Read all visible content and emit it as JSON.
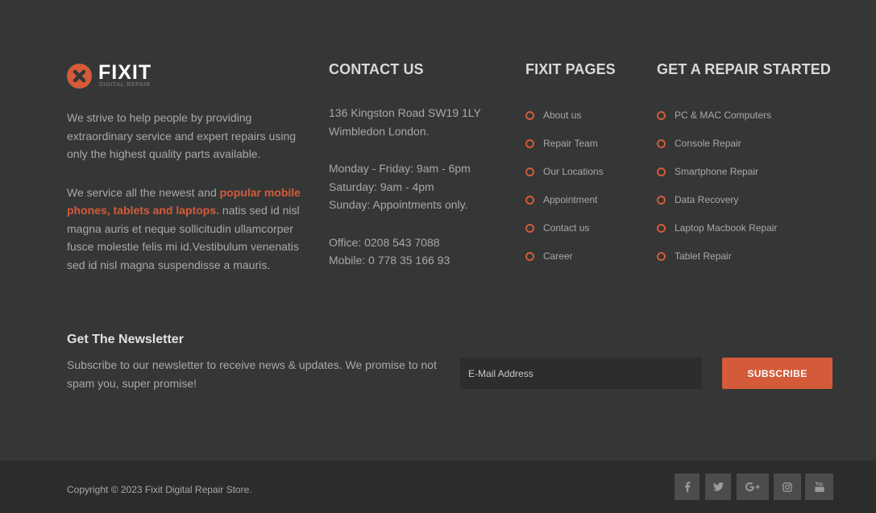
{
  "brand": {
    "name": "FIXIT",
    "tagline": "DIGITAL REPAIR",
    "accent_color": "#d35b3a"
  },
  "about": {
    "paragraph1": "We strive to help people by providing extraordinary service and expert repairs using only the highest quality parts available.",
    "paragraph2_before": "We service all the newest and ",
    "paragraph2_highlight": "popular mobile phones, tablets and laptops.",
    "paragraph2_after": " natis sed id nisl magna auris et neque sollicitudin ullamcorper fusce molestie felis mi id.Vestibulum venenatis sed id nisl magna suspendisse a mauris."
  },
  "contact": {
    "heading": "CONTACT US",
    "address_line1": "136 Kingston Road SW19 1LY",
    "address_line2": "Wimbledon London.",
    "hours_line1": "Monday - Friday: 9am - 6pm",
    "hours_line2": "Saturday: 9am - 4pm",
    "hours_line3": "Sunday: Appointments only.",
    "office": "Office: 0208 543 7088",
    "mobile": "Mobile: 0 778 35 166 93"
  },
  "pages": {
    "heading": "FIXIT PAGES",
    "items": [
      "About us",
      "Repair Team",
      "Our Locations",
      "Appointment",
      "Contact us",
      "Career"
    ]
  },
  "repair": {
    "heading": "GET A REPAIR STARTED",
    "items": [
      "PC & MAC Computers",
      "Console Repair",
      "Smartphone Repair",
      "Data Recovery",
      "Laptop Macbook Repair",
      "Tablet Repair"
    ]
  },
  "newsletter": {
    "title": "Get The Newsletter",
    "text": "Subscribe to our newsletter to receive news & updates. We promise to not spam you, super promise!",
    "email_placeholder": "E-Mail Address",
    "email_value": "",
    "button_label": "SUBSCRIBE"
  },
  "footer": {
    "copyright": "Copyright © 2023 Fixit Digital Repair Store."
  },
  "social": [
    {
      "name": "facebook-icon",
      "glyph": "f"
    },
    {
      "name": "twitter-icon",
      "glyph": ""
    },
    {
      "name": "google-plus-icon",
      "glyph": "G+"
    },
    {
      "name": "instagram-icon",
      "glyph": ""
    },
    {
      "name": "youtube-icon",
      "glyph": ""
    }
  ]
}
